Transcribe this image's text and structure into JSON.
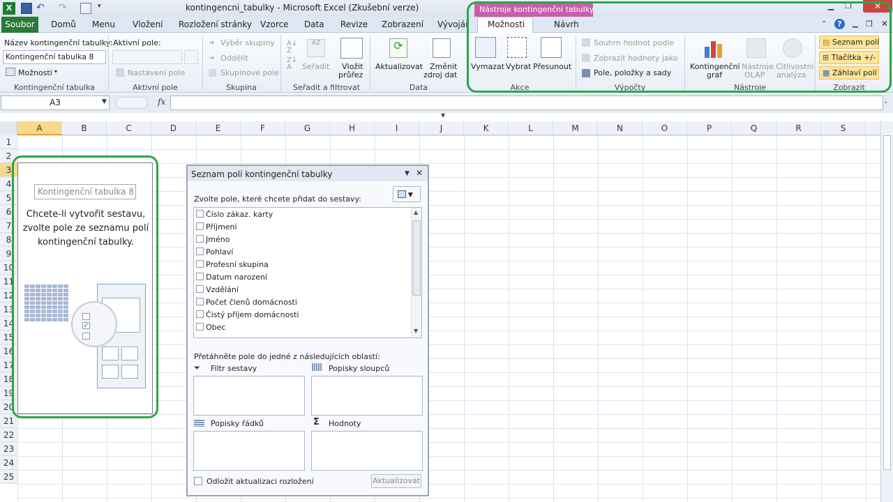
{
  "window": {
    "title": "kontingencni_tabulky  -  Microsoft Excel (Zkušební verze)",
    "context_band": "Nástroje kontingenční tabulky"
  },
  "tabs": {
    "file": "Soubor",
    "items": [
      "Domů",
      "Menu",
      "Vložení",
      "Rozložení stránky",
      "Vzorce",
      "Data",
      "Revize",
      "Zobrazení",
      "Vývojář"
    ],
    "ctx_items": [
      "Možnosti",
      "Návrh"
    ]
  },
  "ribbon": {
    "kt_name_label": "Název kontingenční tabulky:",
    "kt_name_value": "Kontingenční tabulka 8",
    "kt_options": "Možnosti",
    "active_field_label": "Aktivní pole:",
    "field_settings": "Nastavení pole",
    "group_select": "Výběr skupiny",
    "ungroup": "Oddělit",
    "group_field": "Skupinové pole",
    "sort": "Seřadit",
    "insert_slicer": "Vložit",
    "insert_slicer2": "průřez",
    "refresh": "Aktualizovat",
    "change_source": "Změnit",
    "change_source2": "zdroj dat",
    "clear": "Vymazat",
    "select": "Vybrat",
    "move": "Přesunout",
    "summarize": "Souhrn hodnot podle",
    "show_values": "Zobrazit hodnoty jako",
    "fields_items": "Pole, položky a sady",
    "pivot_chart": "Kontingenční",
    "pivot_chart2": "graf",
    "olap": "Nástroje",
    "olap2": "OLAP",
    "whatif": "Citlivostní",
    "whatif2": "analýza",
    "field_list": "Seznam polí",
    "buttons": "Tlačítka +/-",
    "headers": "Záhlaví polí",
    "groups": [
      "Kontingenční tabulka",
      "Aktivní pole",
      "Skupina",
      "Seřadit a filtrovat",
      "Data",
      "Akce",
      "Výpočty",
      "Nástroje",
      "Zobrazit"
    ]
  },
  "formula_bar": {
    "name_box": "A3",
    "fx": "fx"
  },
  "grid": {
    "columns": [
      "A",
      "B",
      "C",
      "D",
      "E",
      "F",
      "G",
      "H",
      "I",
      "J",
      "K",
      "L",
      "M",
      "N",
      "O",
      "P",
      "Q",
      "R",
      "S"
    ],
    "rows": [
      "1",
      "2",
      "3",
      "4",
      "5",
      "6",
      "7",
      "8",
      "9",
      "10",
      "11",
      "12",
      "13",
      "14",
      "15",
      "16",
      "17",
      "18",
      "19",
      "20",
      "21",
      "22",
      "23",
      "24",
      "25"
    ]
  },
  "pivot_placeholder": {
    "name": "Kontingenční tabulka 8",
    "message": "Chcete-li vytvořit sestavu, zvolte pole ze seznamu polí kontingenční tabulky."
  },
  "field_panel": {
    "title": "Seznam polí kontingenční tabulky",
    "choose_label": "Zvolte pole, které chcete přidat do sestavy:",
    "fields": [
      "Číslo zákaz. karty",
      "Příjmení",
      "Jméno",
      "Pohlaví",
      "Profesní skupina",
      "Datum narození",
      "Vzdělání",
      "Počet členů domácnosti",
      "Čistý příjem domácnosti",
      "Obec"
    ],
    "drag_label": "Přetáhněte pole do jedné z následujících oblastí:",
    "report_filter": "Filtr sestavy",
    "column_labels": "Popisky sloupců",
    "row_labels": "Popisky řádků",
    "values": "Hodnoty",
    "defer_label": "Odložit aktualizaci rozložení",
    "update_button": "Aktualizovat"
  }
}
